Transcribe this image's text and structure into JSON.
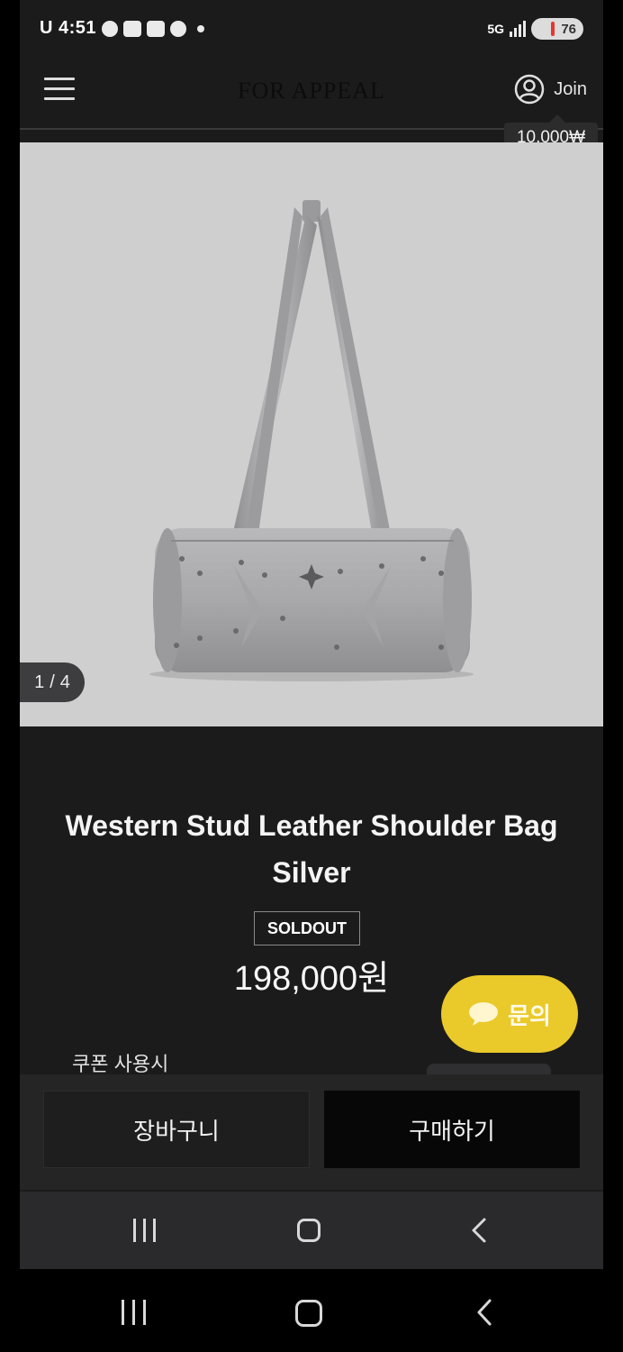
{
  "status_bar": {
    "time": "U 4:51",
    "battery": "76",
    "network": "5G"
  },
  "header": {
    "logo": "FOR APPEAL",
    "join_label": "Join",
    "coupon_amount": "10,000₩"
  },
  "gallery": {
    "current": "1",
    "separator": "/",
    "total": "4"
  },
  "product": {
    "name": "Western Stud Leather Shoulder Bag Silver",
    "badge": "SOLDOUT",
    "price": "198,000원",
    "coupon_label": "쿠폰 사용시"
  },
  "inquiry": {
    "label": "문의",
    "color": "#eac92a"
  },
  "actions": {
    "cart_label": "장바구니",
    "buy_label": "구매하기"
  },
  "icons": {
    "menu": "hamburger-menu-icon",
    "user": "user-circle-icon",
    "chat": "chat-bubble-icon",
    "recents": "recent-apps-icon",
    "home": "home-icon",
    "back": "back-chevron-icon"
  }
}
